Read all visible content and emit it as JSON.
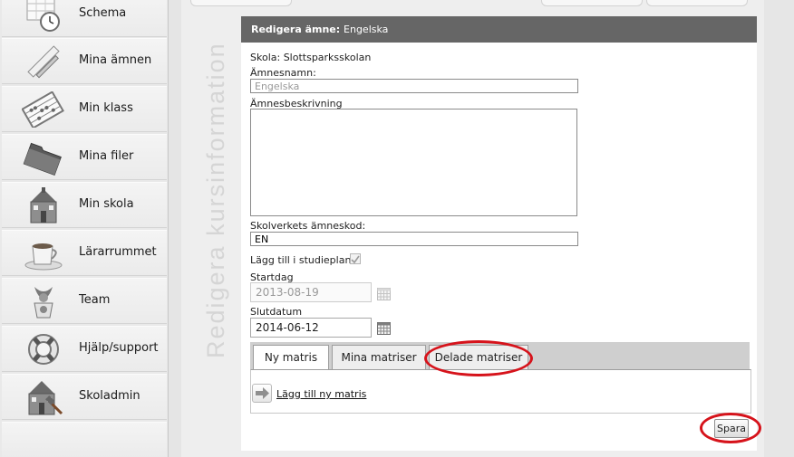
{
  "sidebar": {
    "items": [
      {
        "label": "Schema",
        "icon": "calendar-clock-icon"
      },
      {
        "label": "Mina ämnen",
        "icon": "ruler-pencil-icon"
      },
      {
        "label": "Min klass",
        "icon": "abacus-icon"
      },
      {
        "label": "Mina filer",
        "icon": "folder-icon"
      },
      {
        "label": "Min skola",
        "icon": "school-building-icon"
      },
      {
        "label": "Lärarrummet",
        "icon": "coffee-cup-icon"
      },
      {
        "label": "Team",
        "icon": "team-trophy-icon"
      },
      {
        "label": "Hjälp/support",
        "icon": "lifebuoy-icon"
      },
      {
        "label": "Skoladmin",
        "icon": "school-admin-icon"
      }
    ]
  },
  "vertical_title": "Redigera kursinformation",
  "panel": {
    "header_prefix": "Redigera ämne:",
    "header_subject": "Engelska",
    "school_line": "Skola: Slottsparksskolan",
    "subject_name_label": "Ämnesnamn:",
    "subject_name_value": "Engelska",
    "description_label": "Ämnesbeskrivning",
    "description_value": "",
    "code_label": "Skolverkets ämneskod:",
    "code_value": "EN",
    "studyplan_label": "Lägg till i studieplan:",
    "studyplan_checked": true,
    "start_label": "Startdag",
    "start_value": "2013-08-19",
    "end_label": "Slutdatum",
    "end_value": "2014-06-12"
  },
  "tabs": [
    {
      "label": "Ny matris",
      "active": true
    },
    {
      "label": "Mina matriser",
      "active": false
    },
    {
      "label": "Delade matriser",
      "active": false
    }
  ],
  "add_matrix_label": "Lägg till ny matris",
  "save_label": "Spara",
  "colors": {
    "header_bg": "#666666",
    "annotation_red": "#d6131b",
    "panel_bg": "#ffffff"
  }
}
